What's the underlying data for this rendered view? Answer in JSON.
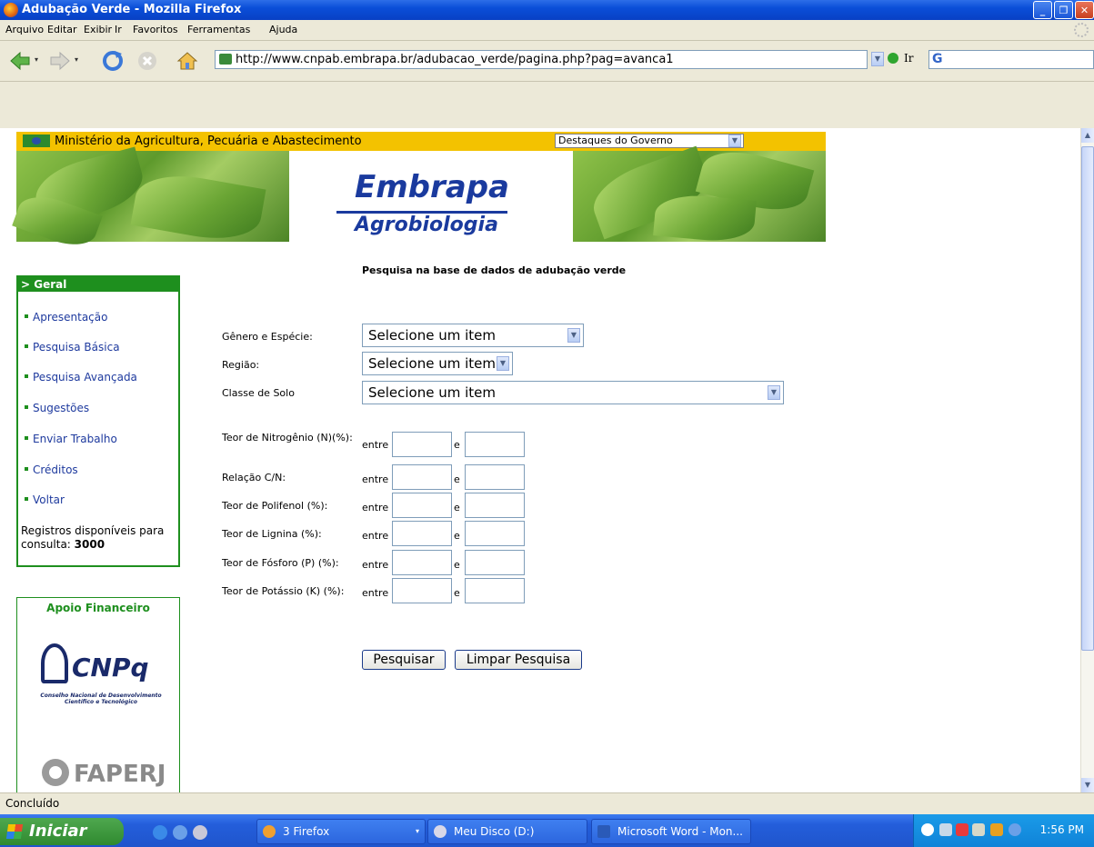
{
  "window": {
    "title": "Adubação Verde - Mozilla Firefox"
  },
  "menu": {
    "items": [
      "Arquivo",
      "Editar",
      "Exibir",
      "Ir",
      "Favoritos",
      "Ferramentas",
      "Ajuda"
    ]
  },
  "navbar": {
    "url": "http://www.cnpab.embrapa.br/adubacao_verde/pagina.php?pag=avanca1",
    "go_label": "Ir",
    "icons": [
      "back-icon",
      "forward-icon",
      "reload-icon",
      "stop-icon",
      "home-icon"
    ]
  },
  "header": {
    "ministry": "Ministério da Agricultura, Pecuária e Abastecimento",
    "destaques": "Destaques do Governo",
    "logo_top": "Embrapa",
    "logo_bottom": "Agrobiologia"
  },
  "sidebar": {
    "heading": "> Geral",
    "items": [
      {
        "label": "Apresentação"
      },
      {
        "label": "Pesquisa Básica"
      },
      {
        "label": "Pesquisa Avançada"
      },
      {
        "label": "Sugestões"
      },
      {
        "label": "Enviar Trabalho"
      },
      {
        "label": "Créditos"
      },
      {
        "label": "Voltar"
      }
    ],
    "registros_text": "Registros disponíveis para consulta:",
    "registros_count": "3000",
    "apoio": "Apoio Financeiro",
    "cnpq": "CNPq",
    "cnpq_sub": "Conselho Nacional de Desenvolvimento Científico e Tecnológico",
    "faperj": "FAPERJ"
  },
  "form": {
    "title": "Pesquisa na base de dados de adubação verde",
    "genero_label": "Gênero e Espécie:",
    "regiao_label": "Região:",
    "classe_label": "Classe de Solo",
    "select_placeholder": "Selecione um item",
    "between": "entre",
    "and": "e",
    "ranges": [
      {
        "label": "Teor de Nitrogênio (N)(%):"
      },
      {
        "label": "Relação C/N:"
      },
      {
        "label": "Teor de Polifenol (%):"
      },
      {
        "label": "Teor de Lignina (%):"
      },
      {
        "label": "Teor de Fósforo (P) (%):"
      },
      {
        "label": "Teor de Potássio (K) (%):"
      }
    ],
    "search_button": "Pesquisar",
    "clear_button": "Limpar Pesquisa"
  },
  "status": {
    "text": "Concluído"
  },
  "taskbar": {
    "start": "Iniciar",
    "tasks": [
      "3 Firefox",
      "Meu Disco (D:)",
      "Microsoft Word - Mon..."
    ],
    "clock": "1:56 PM"
  },
  "colors": {
    "ministry_bar": "#f3c200",
    "sidebar_green": "#1e8f1e",
    "embrapa_blue": "#1a3a9e"
  }
}
